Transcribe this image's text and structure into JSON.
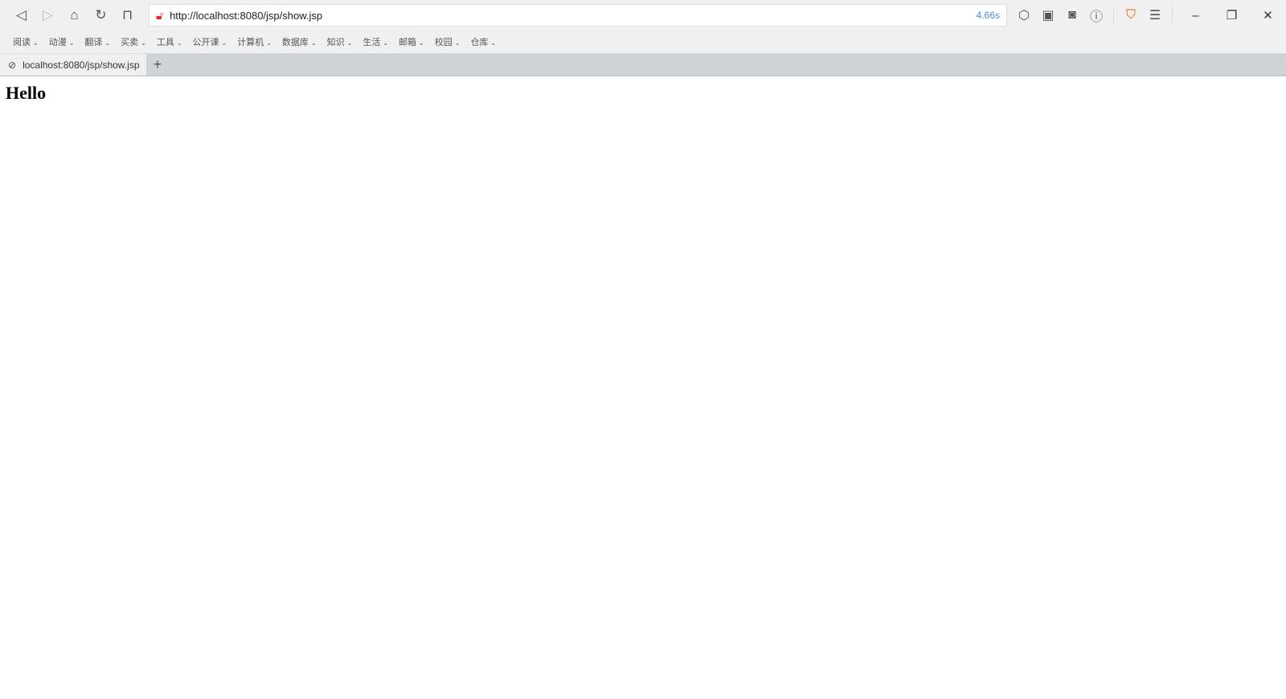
{
  "browser": {
    "url": "http://localhost:8080/jsp/show.jsp",
    "load_time": "4.66s",
    "bookmarks": [
      "阅读",
      "动漫",
      "翻译",
      "买卖",
      "工具",
      "公开课",
      "计算机",
      "数据库",
      "知识",
      "生活",
      "邮箱",
      "校园",
      "仓库"
    ],
    "tab_title": "localhost:8080/jsp/show.jsp",
    "accent": "#e0262b"
  },
  "page": {
    "heading": "Hello"
  }
}
